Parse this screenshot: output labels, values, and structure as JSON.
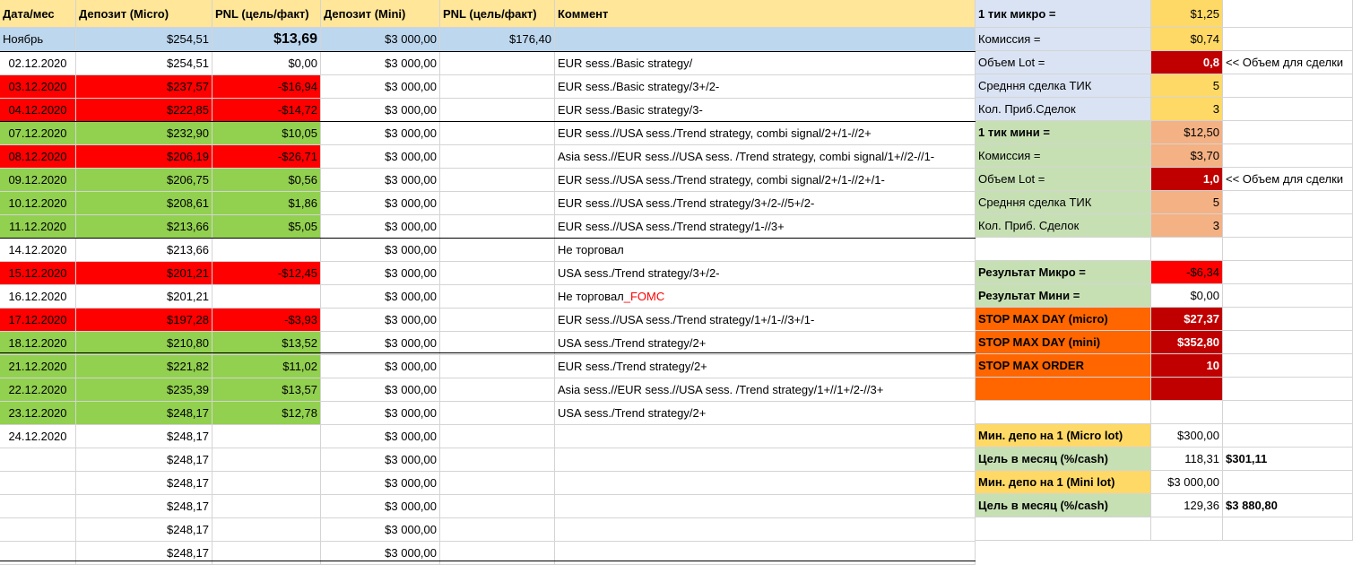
{
  "headers": [
    "Дата/мес",
    "Депозит (Micro)",
    "PNL (цель/факт)",
    "Депозит (Mini)",
    "PNL (цель/факт)",
    "Коммент"
  ],
  "summary_row": {
    "label": "Ноябрь",
    "dep_micro": "$254,51",
    "pnl_micro": "$13,69",
    "dep_mini": "$3 000,00",
    "pnl_mini": "$176,40"
  },
  "rows": [
    {
      "date": "02.12.2020",
      "dep_micro": "$254,51",
      "pnl_micro": "$0,00",
      "dep_mini": "$3 000,00",
      "comment": "EUR sess./Basic strategy/",
      "status": "neutral"
    },
    {
      "date": "03.12.2020",
      "dep_micro": "$237,57",
      "pnl_micro": "-$16,94",
      "dep_mini": "$3 000,00",
      "comment": "EUR sess./Basic strategy/3+/2-",
      "status": "loss"
    },
    {
      "date": "04.12.2020",
      "dep_micro": "$222,85",
      "pnl_micro": "-$14,72",
      "dep_mini": "$3 000,00",
      "comment": "EUR sess./Basic strategy/3-",
      "status": "loss"
    },
    {
      "date": "07.12.2020",
      "dep_micro": "$232,90",
      "pnl_micro": "$10,05",
      "dep_mini": "$3 000,00",
      "comment": "EUR sess.//USA sess./Trend strategy, combi signal/2+/1-//2+",
      "status": "profit"
    },
    {
      "date": "08.12.2020",
      "dep_micro": "$206,19",
      "pnl_micro": "-$26,71",
      "dep_mini": "$3 000,00",
      "comment": "Asia sess.//EUR sess.//USA sess. /Trend strategy, combi signal/1+//2-//1-",
      "status": "loss"
    },
    {
      "date": "09.12.2020",
      "dep_micro": "$206,75",
      "pnl_micro": "$0,56",
      "dep_mini": "$3 000,00",
      "comment": "EUR sess.//USA sess./Trend strategy, combi signal/2+/1-//2+/1-",
      "status": "profit"
    },
    {
      "date": "10.12.2020",
      "dep_micro": "$208,61",
      "pnl_micro": "$1,86",
      "dep_mini": "$3 000,00",
      "comment": "EUR sess.//USA sess./Trend strategy/3+/2-//5+/2-",
      "status": "profit"
    },
    {
      "date": "11.12.2020",
      "dep_micro": "$213,66",
      "pnl_micro": "$5,05",
      "dep_mini": "$3 000,00",
      "comment": "EUR sess.//USA sess./Trend strategy/1-//3+",
      "status": "profit"
    },
    {
      "date": "14.12.2020",
      "dep_micro": "$213,66",
      "pnl_micro": "",
      "dep_mini": "$3 000,00",
      "comment": "Не торговал",
      "status": "neutral"
    },
    {
      "date": "15.12.2020",
      "dep_micro": "$201,21",
      "pnl_micro": "-$12,45",
      "dep_mini": "$3 000,00",
      "comment": "USA sess./Trend strategy/3+/2-",
      "status": "loss"
    },
    {
      "date": "16.12.2020",
      "dep_micro": "$201,21",
      "pnl_micro": "",
      "dep_mini": "$3 000,00",
      "comment": "Не торговал",
      "comment_extra": "_FOMC",
      "status": "neutral"
    },
    {
      "date": "17.12.2020",
      "dep_micro": "$197,28",
      "pnl_micro": "-$3,93",
      "dep_mini": "$3 000,00",
      "comment": "EUR sess.//USA sess./Trend strategy/1+/1-//3+/1-",
      "status": "loss"
    },
    {
      "date": "18.12.2020",
      "dep_micro": "$210,80",
      "pnl_micro": "$13,52",
      "dep_mini": "$3 000,00",
      "comment": "USA sess./Trend strategy/2+",
      "status": "profit"
    },
    {
      "date": "21.12.2020",
      "dep_micro": "$221,82",
      "pnl_micro": "$11,02",
      "dep_mini": "$3 000,00",
      "comment": "EUR sess./Trend strategy/2+",
      "status": "profit"
    },
    {
      "date": "22.12.2020",
      "dep_micro": "$235,39",
      "pnl_micro": "$13,57",
      "dep_mini": "$3 000,00",
      "comment": "Asia sess.//EUR sess.//USA sess. /Trend strategy/1+//1+/2-//3+",
      "status": "profit"
    },
    {
      "date": "23.12.2020",
      "dep_micro": "$248,17",
      "pnl_micro": "$12,78",
      "dep_mini": "$3 000,00",
      "comment": "USA sess./Trend strategy/2+",
      "status": "profit"
    },
    {
      "date": "24.12.2020",
      "dep_micro": "$248,17",
      "pnl_micro": "",
      "dep_mini": "$3 000,00",
      "comment": "",
      "status": "neutral"
    },
    {
      "date": "",
      "dep_micro": "$248,17",
      "pnl_micro": "",
      "dep_mini": "$3 000,00",
      "comment": "",
      "status": "neutral"
    },
    {
      "date": "",
      "dep_micro": "$248,17",
      "pnl_micro": "",
      "dep_mini": "$3 000,00",
      "comment": "",
      "status": "neutral"
    },
    {
      "date": "",
      "dep_micro": "$248,17",
      "pnl_micro": "",
      "dep_mini": "$3 000,00",
      "comment": "",
      "status": "neutral"
    },
    {
      "date": "",
      "dep_micro": "$248,17",
      "pnl_micro": "",
      "dep_mini": "$3 000,00",
      "comment": "",
      "status": "neutral"
    },
    {
      "date": "",
      "dep_micro": "$248,17",
      "pnl_micro": "",
      "dep_mini": "$3 000,00",
      "comment": "",
      "status": "neutral"
    }
  ],
  "side": [
    {
      "label": "1 тик микро =",
      "value": "$1,25",
      "note": "",
      "style": "tick"
    },
    {
      "label": "Комиссия =",
      "value": "$0,74",
      "note": "",
      "style": "lav"
    },
    {
      "label": "Объем  Lot =",
      "value": "0,8",
      "note": "<< Объем для сделки",
      "style": "lotlav"
    },
    {
      "label": "Средння сделка ТИК",
      "value": "5",
      "note": "",
      "style": "lav"
    },
    {
      "label": "Кол. Приб.Сделок",
      "value": "3",
      "note": "",
      "style": "lav"
    },
    {
      "label": "1 тик мини =",
      "value": "$12,50",
      "note": "",
      "style": "tickgreen"
    },
    {
      "label": "Комиссия =",
      "value": "$3,70",
      "note": "",
      "style": "lgreen"
    },
    {
      "label": "Объем  Lot =",
      "value": "1,0",
      "note": "<< Объем для сделки",
      "style": "lotgreen"
    },
    {
      "label": "Средння сделка ТИК",
      "value": "5",
      "note": "",
      "style": "lgreen"
    },
    {
      "label": "Кол. Приб. Сделок",
      "value": "3",
      "note": "",
      "style": "lgreen"
    },
    {
      "label": "",
      "value": "",
      "note": "",
      "style": "blank"
    },
    {
      "label": "Результат Микро =",
      "value": "-$6,34",
      "note": "",
      "style": "resmicro"
    },
    {
      "label": "Результат Мини =",
      "value": "$0,00",
      "note": "",
      "style": "resmini"
    },
    {
      "label": "STOP MAX DAY (micro)",
      "value": "$27,37",
      "note": "",
      "style": "stop"
    },
    {
      "label": "STOP MAX DAY (mini)",
      "value": "$352,80",
      "note": "",
      "style": "stop"
    },
    {
      "label": "STOP MAX ORDER",
      "value": "10",
      "note": "",
      "style": "stop"
    },
    {
      "label": "",
      "value": "",
      "note": "",
      "style": "stopblank"
    },
    {
      "label": "",
      "value": "",
      "note": "",
      "style": "blank"
    },
    {
      "label": "Мин. депо на 1 (Micro lot)",
      "value": "$300,00",
      "note": "",
      "style": "mindepo"
    },
    {
      "label": "Цель в месяц (%/cash)",
      "value": "118,31",
      "note": "$301,11",
      "style": "goal"
    },
    {
      "label": "Мин. депо на 1 (Mini lot)",
      "value": "$3 000,00",
      "note": "",
      "style": "mindepo"
    },
    {
      "label": "Цель в месяц (%/cash)",
      "value": "129,36",
      "note": "$3 880,80",
      "style": "goal"
    },
    {
      "label": "",
      "value": "",
      "note": "",
      "style": "blank"
    }
  ],
  "colors": {
    "header": "#ffe699",
    "summary": "#bdd7ee",
    "loss": "#ff0000",
    "profit": "#92d050",
    "lavender": "#dae3f3",
    "light_green": "#c6e0b4",
    "peach": "#f4b183",
    "gold": "#ffd966",
    "dark_red": "#c00000",
    "orange": "#ff6600"
  }
}
